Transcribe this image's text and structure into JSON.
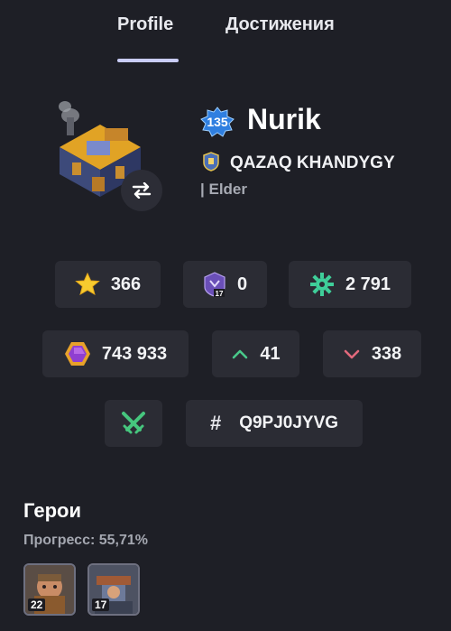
{
  "tabs": [
    {
      "label": "Profile",
      "active": true
    },
    {
      "label": "Достижения",
      "active": false
    }
  ],
  "player": {
    "level": "135",
    "name": "Nurik",
    "clan": "QAZAQ KHANDYGY",
    "role": "| Elder"
  },
  "stats": {
    "trophies": "366",
    "league_badge_number": "17",
    "league_value": "0",
    "builder_trophies": "2 791",
    "elixir": "743 933",
    "up": "41",
    "down": "338",
    "tag": "Q9PJ0JYVG"
  },
  "heroes": {
    "title": "Герои",
    "progress": "Прогресс: 55,71%",
    "items": [
      {
        "level": "22",
        "icon": "hero-portrait-icon"
      },
      {
        "level": "17",
        "icon": "hero-portrait-icon"
      }
    ]
  },
  "colors": {
    "background": "#1e1f26",
    "chip": "#2b2c34",
    "up": "#49c98a",
    "down": "#e2697c",
    "accent_tab": "#c9ccf7"
  }
}
